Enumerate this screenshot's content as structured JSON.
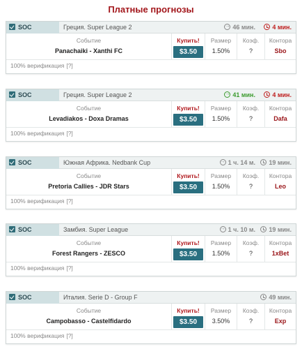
{
  "page": {
    "title": "Платные прогнозы"
  },
  "columns": {
    "event": "Событие",
    "buy": "Купить!",
    "size": "Размер",
    "coef": "Коэф.",
    "bookmaker": "Контора"
  },
  "verification": {
    "text": "100% верификация",
    "help": "[?]"
  },
  "colors": {
    "accent": "#2a6f80",
    "title": "#a3171c",
    "countdown_red": "#bf1f1f",
    "countdown_green": "#3c9b2f"
  },
  "tips": [
    {
      "sport": "SOC",
      "league": "Греция. Super League 2",
      "start_time": "46 мин.",
      "start_icon": "arrow-circle-icon",
      "start_color": "grey",
      "time_left": "4 мин.",
      "left_color": "red",
      "event": "Panachaiki - Xanthi FC",
      "price": "$3.50",
      "size": "1.50%",
      "coef": "?",
      "bookmaker": "Sbo"
    },
    {
      "sport": "SOC",
      "league": "Греция. Super League 2",
      "start_time": "41 мин.",
      "start_icon": "arrow-circle-icon",
      "start_color": "green",
      "time_left": "4 мин.",
      "left_color": "red",
      "event": "Levadiakos - Doxa Dramas",
      "price": "$3.50",
      "size": "1.50%",
      "coef": "?",
      "bookmaker": "Dafa"
    },
    {
      "sport": "SOC",
      "league": "Южная Африка. Nedbank Cup",
      "start_time": "1 ч. 14 м.",
      "start_icon": "arrow-circle-icon",
      "start_color": "grey",
      "time_left": "19 мин.",
      "left_color": "grey",
      "event": "Pretoria Callies - JDR Stars",
      "price": "$3.50",
      "size": "1.50%",
      "coef": "?",
      "bookmaker": "Leo"
    },
    {
      "sport": "SOC",
      "league": "Замбия. Super League",
      "start_time": "1 ч. 10 м.",
      "start_icon": "arrow-circle-icon",
      "start_color": "grey",
      "time_left": "19 мин.",
      "left_color": "grey",
      "event": "Forest Rangers - ZESCO",
      "price": "$3.50",
      "size": "1.50%",
      "coef": "?",
      "bookmaker": "1xBet"
    },
    {
      "sport": "SOC",
      "league": "Италия. Serie D - Group F",
      "start_time": "",
      "start_icon": "",
      "start_color": "grey",
      "time_left": "49 мин.",
      "left_color": "grey",
      "event": "Campobasso - Castelfidardo",
      "price": "$3.50",
      "size": "3.50%",
      "coef": "?",
      "bookmaker": "Exp"
    }
  ]
}
